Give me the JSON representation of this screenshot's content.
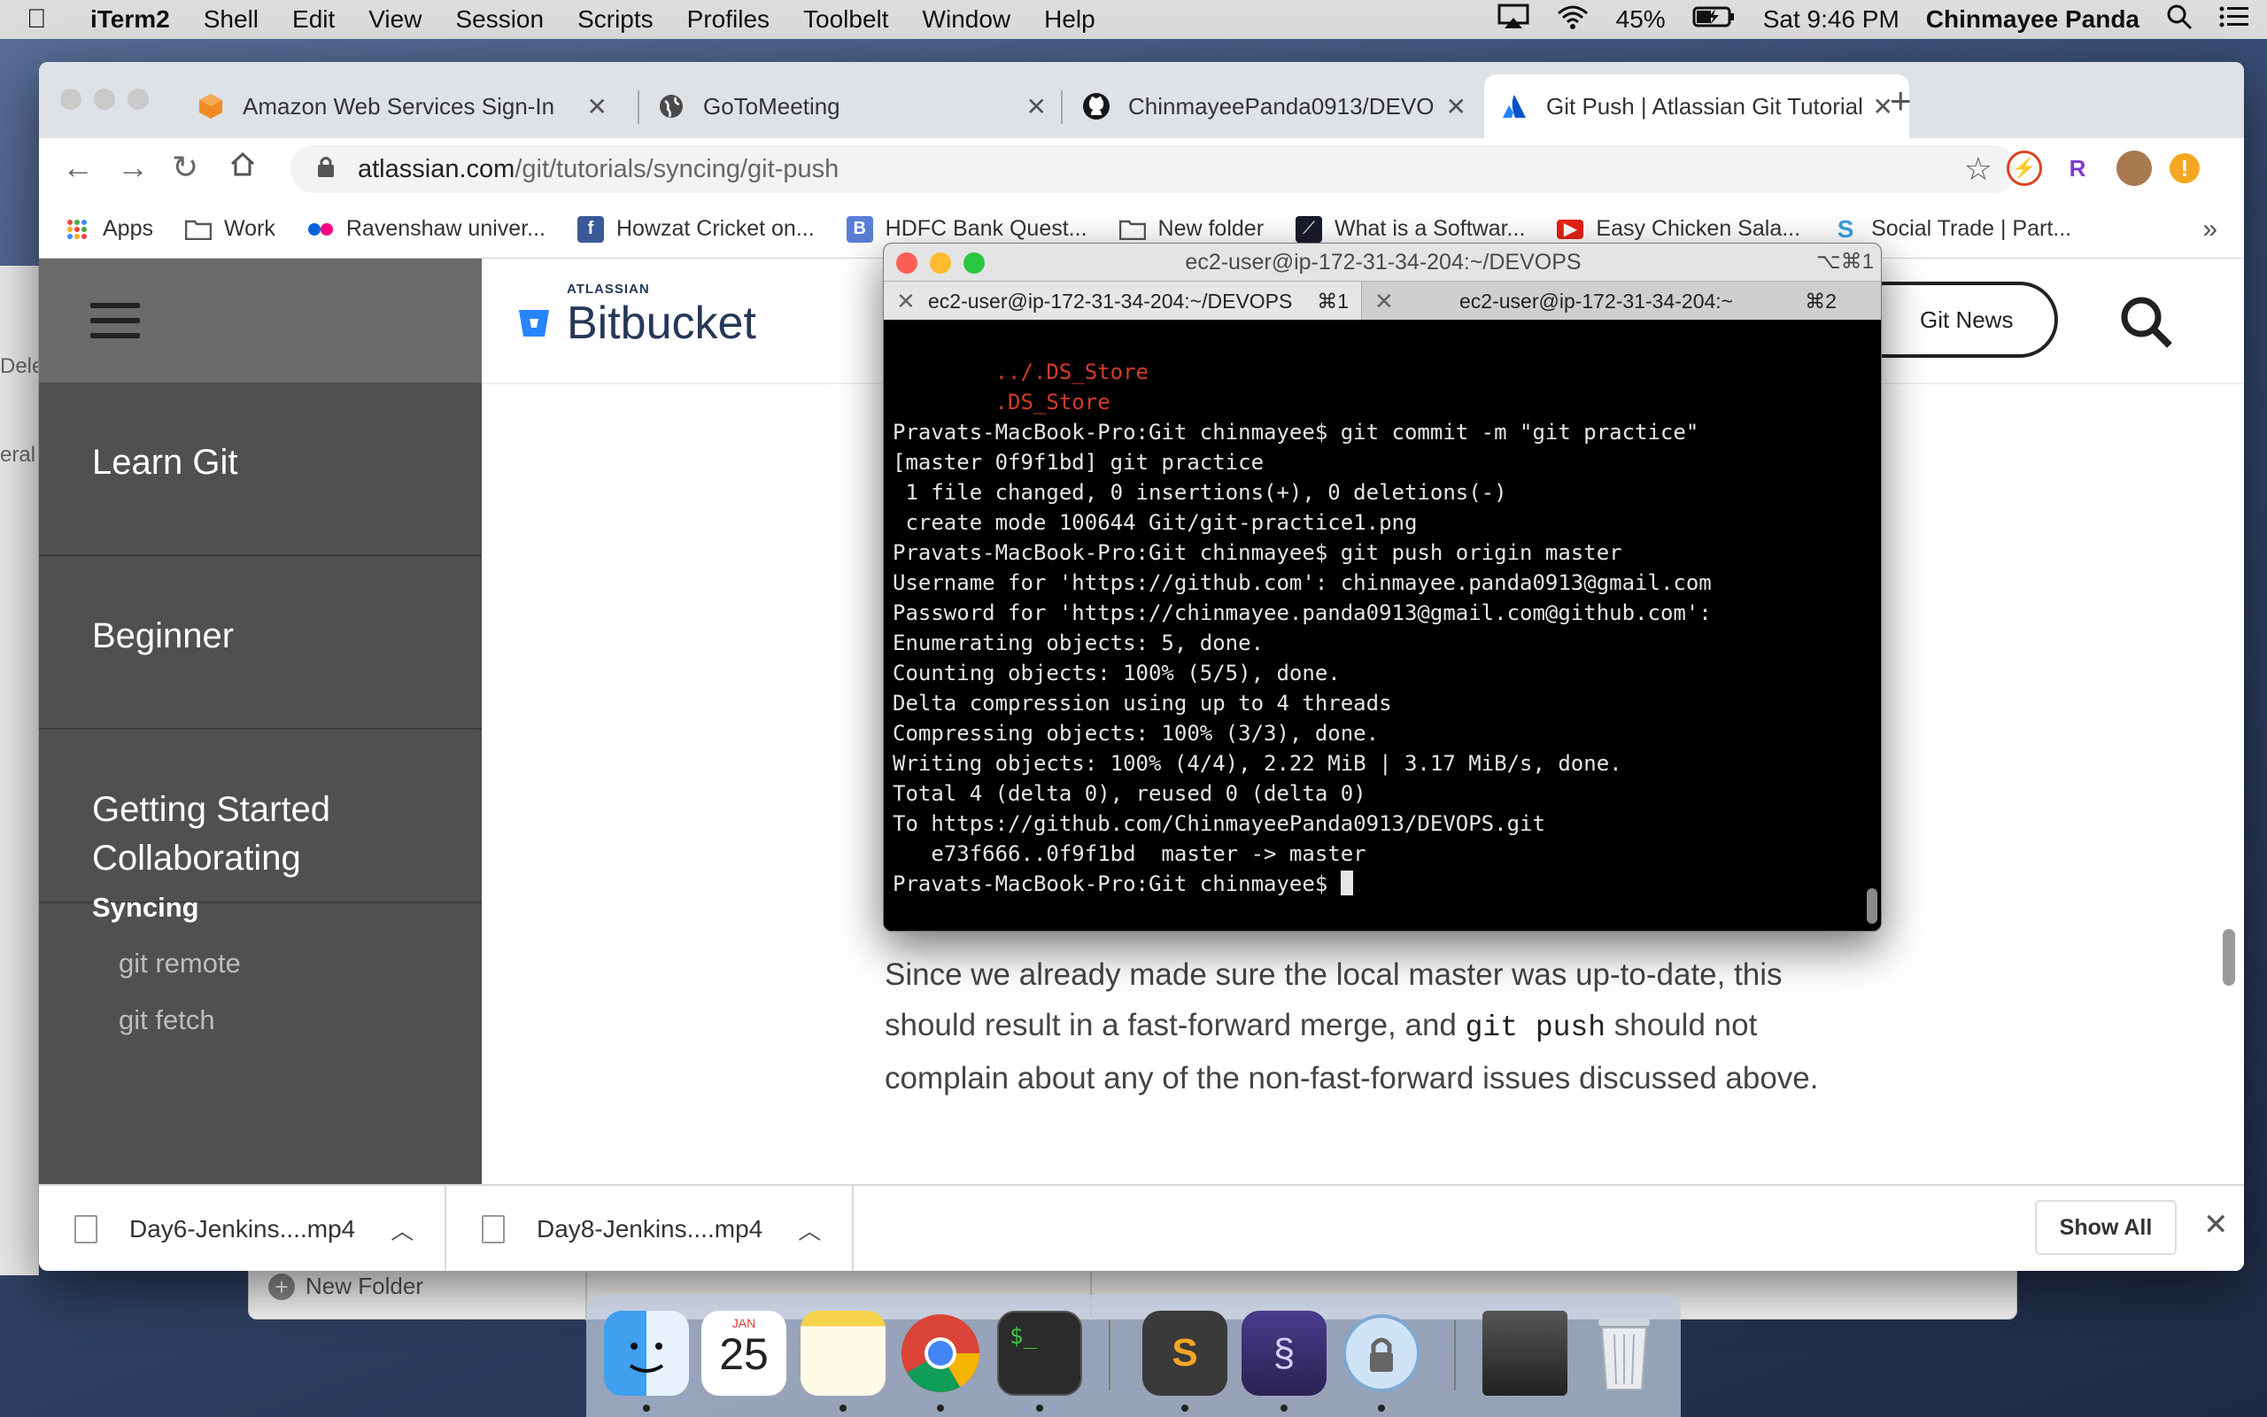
{
  "menubar": {
    "app_name": "iTerm2",
    "menus": [
      "Shell",
      "Edit",
      "View",
      "Session",
      "Scripts",
      "Profiles",
      "Toolbelt",
      "Window",
      "Help"
    ],
    "battery": "45%",
    "clock": "Sat 9:46 PM",
    "user": "Chinmayee Panda"
  },
  "browser": {
    "tabs": [
      {
        "title": "Amazon Web Services Sign-In",
        "icon": "aws-cube-icon"
      },
      {
        "title": "GoToMeeting",
        "icon": "globe-icon"
      },
      {
        "title": "ChinmayeePanda0913/DEVOPS",
        "icon": "github-icon"
      },
      {
        "title": "Git Push | Atlassian Git Tutorial",
        "icon": "atlassian-icon",
        "active": true
      }
    ],
    "url_host": "atlassian.com",
    "url_path": "/git/tutorials/syncing/git-push",
    "bookmarks": [
      {
        "label": "Apps",
        "icon": "apps-grid-icon"
      },
      {
        "label": "Work",
        "icon": "folder-icon"
      },
      {
        "label": "Ravenshaw univer...",
        "icon": "flickr-dots-icon"
      },
      {
        "label": "Howzat Cricket on...",
        "icon": "facebook-icon"
      },
      {
        "label": "HDFC Bank Quest...",
        "icon": "b-icon"
      },
      {
        "label": "New folder",
        "icon": "folder-icon"
      },
      {
        "label": "What is a Softwar...",
        "icon": "bookmark-logo-icon"
      },
      {
        "label": "Easy Chicken Sala...",
        "icon": "youtube-icon"
      },
      {
        "label": "Social Trade | Part...",
        "icon": "s-logo-icon"
      }
    ]
  },
  "page": {
    "logo_small": "ATLASSIAN",
    "logo_big": "Bitbucket",
    "git_news": "Git News",
    "sidebar": {
      "items": [
        "Learn Git",
        "Beginner",
        "Getting Started"
      ],
      "collaborating": "Collaborating",
      "syncing": "Syncing",
      "sub_items": [
        "git remote",
        "git fetch"
      ]
    },
    "article": {
      "part1": "Since we already made sure the local master was up-to-date, this should result in a fast-forward merge, and ",
      "code": "git push",
      "part2": " should not complain about any of the non-fast-forward issues discussed above."
    }
  },
  "downloads": {
    "items": [
      "Day6-Jenkins....mp4",
      "Day8-Jenkins....mp4"
    ],
    "show_all": "Show All"
  },
  "finder": {
    "new_folder": "New Folder",
    "side_fragments": [
      "Delet",
      "eral"
    ]
  },
  "iterm": {
    "window_title": "ec2-user@ip-172-31-34-204:~/DEVOPS",
    "window_shortcut": "⌥⌘1",
    "tabs": [
      {
        "title": "ec2-user@ip-172-31-34-204:~/DEVOPS",
        "key": "⌘1"
      },
      {
        "title": "ec2-user@ip-172-31-34-204:~",
        "key": "⌘2"
      }
    ],
    "lines_red": [
      "        ../.DS_Store",
      "        .DS_Store"
    ],
    "lines": [
      "",
      "Pravats-MacBook-Pro:Git chinmayee$ git commit -m \"git practice\"",
      "[master 0f9f1bd] git practice",
      " 1 file changed, 0 insertions(+), 0 deletions(-)",
      " create mode 100644 Git/git-practice1.png",
      "Pravats-MacBook-Pro:Git chinmayee$ git push origin master",
      "Username for 'https://github.com': chinmayee.panda0913@gmail.com",
      "Password for 'https://chinmayee.panda0913@gmail.com@github.com':",
      "Enumerating objects: 5, done.",
      "Counting objects: 100% (5/5), done.",
      "Delta compression using up to 4 threads",
      "Compressing objects: 100% (3/3), done.",
      "Writing objects: 100% (4/4), 2.22 MiB | 3.17 MiB/s, done.",
      "Total 4 (delta 0), reused 0 (delta 0)",
      "To https://github.com/ChinmayeePanda0913/DEVOPS.git",
      "   e73f666..0f9f1bd  master -> master"
    ],
    "prompt": "Pravats-MacBook-Pro:Git chinmayee$ "
  },
  "dock": {
    "apps": [
      "finder-icon",
      "calendar-icon",
      "notes-icon",
      "chrome-icon",
      "terminal-icon",
      "sublime-icon",
      "iterm-icon",
      "keychain-icon",
      "downloads-stack-icon",
      "trash-icon"
    ],
    "calendar_month": "JAN",
    "calendar_day": "25",
    "terminal_glyph": "$_"
  },
  "colors": {
    "menubar_bg": "#dcdcdc",
    "sidebar_bg": "#505050",
    "terminal_red": "#d23b2b",
    "atlassian_blue": "#2684ff"
  }
}
